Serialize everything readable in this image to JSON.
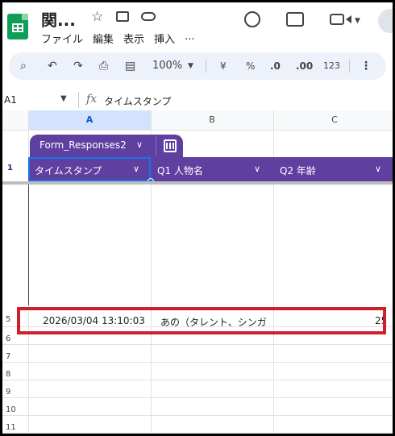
{
  "doc": {
    "title": "関..."
  },
  "menu": [
    "ファイル",
    "編集",
    "表示",
    "挿入",
    "..."
  ],
  "toolbar": {
    "zoom": "100%",
    "currency": "¥",
    "percent": "%",
    "decrease_decimal": ".0",
    "increase_decimal": ".00",
    "format_number": "123"
  },
  "formula_bar": {
    "cell_ref": "A1",
    "fx": "fx",
    "value": "タイムスタンプ"
  },
  "columns": [
    "A",
    "B",
    "C"
  ],
  "table": {
    "name": "Form_Responses2",
    "headers": [
      "タイムスタンプ",
      "Q1 人物名",
      "Q2 年齢"
    ]
  },
  "rows": {
    "header_row": "1",
    "data_row_num": "5",
    "empty_rows": [
      "6",
      "7",
      "8",
      "9",
      "10",
      "11"
    ]
  },
  "data_row": {
    "timestamp": "2026/03/04 13:10:03",
    "person": "あの（タレント、シンガ",
    "age": "25"
  },
  "colors": {
    "table_header": "#5f3fa0",
    "selection": "#1a73e8",
    "highlight": "#cf1f2f",
    "logo": "#0f9d58"
  }
}
